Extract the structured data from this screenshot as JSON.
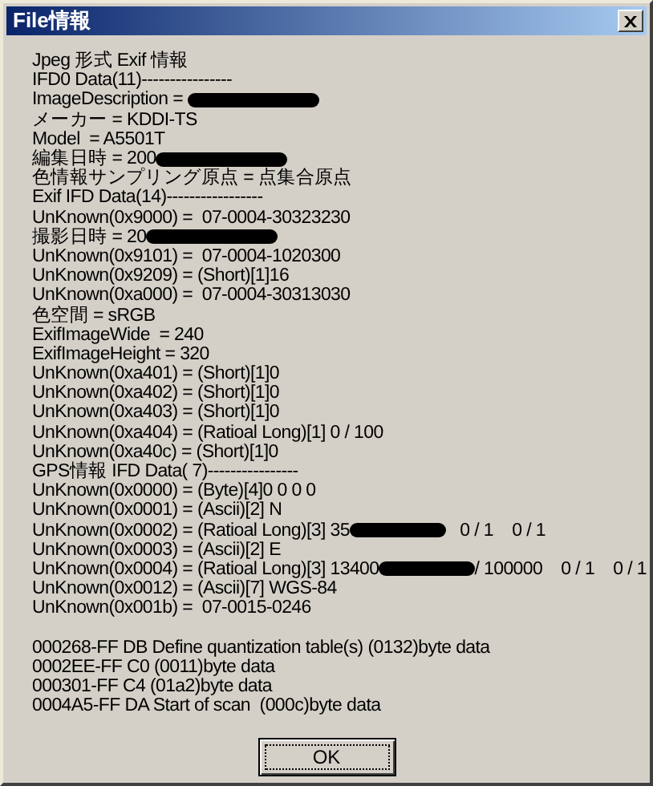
{
  "window": {
    "title": "File情報"
  },
  "exif_lines": [
    {
      "text": "Jpeg 形式 Exif 情報",
      "redacted": false
    },
    {
      "text": "IFD0 Data(11)----------------",
      "redacted": false
    },
    {
      "text": "ImageDescription = ",
      "redacted": true
    },
    {
      "text": "メーカー = KDDI-TS",
      "redacted": false
    },
    {
      "text": "Model  = A5501T",
      "redacted": false
    },
    {
      "text": "編集日時 = 200",
      "redacted": true
    },
    {
      "text": "色情報サンプリング原点 = 点集合原点",
      "redacted": false
    },
    {
      "text": "Exif IFD Data(14)-----------------",
      "redacted": false
    },
    {
      "text": "UnKnown(0x9000) =  07-0004-30323230",
      "redacted": false
    },
    {
      "text": "撮影日時 = 20",
      "redacted": true
    },
    {
      "text": "UnKnown(0x9101) =  07-0004-1020300",
      "redacted": false
    },
    {
      "text": "UnKnown(0x9209) = (Short)[1]16",
      "redacted": false
    },
    {
      "text": "UnKnown(0xa000) =  07-0004-30313030",
      "redacted": false
    },
    {
      "text": "色空間 = sRGB",
      "redacted": false
    },
    {
      "text": "ExifImageWide  = 240",
      "redacted": false
    },
    {
      "text": "ExifImageHeight = 320",
      "redacted": false
    },
    {
      "text": "UnKnown(0xa401) = (Short)[1]0",
      "redacted": false
    },
    {
      "text": "UnKnown(0xa402) = (Short)[1]0",
      "redacted": false
    },
    {
      "text": "UnKnown(0xa403) = (Short)[1]0",
      "redacted": false
    },
    {
      "text": "UnKnown(0xa404) = (Ratioal Long)[1] 0 / 100",
      "redacted": false
    },
    {
      "text": "UnKnown(0xa40c) = (Short)[1]0",
      "redacted": false
    },
    {
      "text": "GPS情報 IFD Data( 7)----------------",
      "redacted": false
    },
    {
      "text": "UnKnown(0x0000) = (Byte)[4]0 0 0 0",
      "redacted": false
    },
    {
      "text": "UnKnown(0x0001) = (Ascii)[2] N",
      "redacted": false
    },
    {
      "text": "UnKnown(0x0002) = (Ratioal Long)[3] 35",
      "redacted": true,
      "after": "   0 / 1    0 / 1"
    },
    {
      "text": "UnKnown(0x0003) = (Ascii)[2] E",
      "redacted": false
    },
    {
      "text": "UnKnown(0x0004) = (Ratioal Long)[3] 13400",
      "redacted": true,
      "after": "/ 100000    0 / 1    0 / 1"
    },
    {
      "text": "UnKnown(0x0012) = (Ascii)[7] WGS-84",
      "redacted": false
    },
    {
      "text": "UnKnown(0x001b) =  07-0015-0246",
      "redacted": false
    }
  ],
  "marker_lines": [
    {
      "text": "000268-FF DB Define quantization table(s) (0132)byte data"
    },
    {
      "text": "0002EE-FF C0 (0011)byte data"
    },
    {
      "text": "000301-FF C4 (01a2)byte data"
    },
    {
      "text": "0004A5-FF DA Start of scan  (000c)byte data"
    }
  ],
  "buttons": [
    {
      "label": "OK"
    }
  ]
}
